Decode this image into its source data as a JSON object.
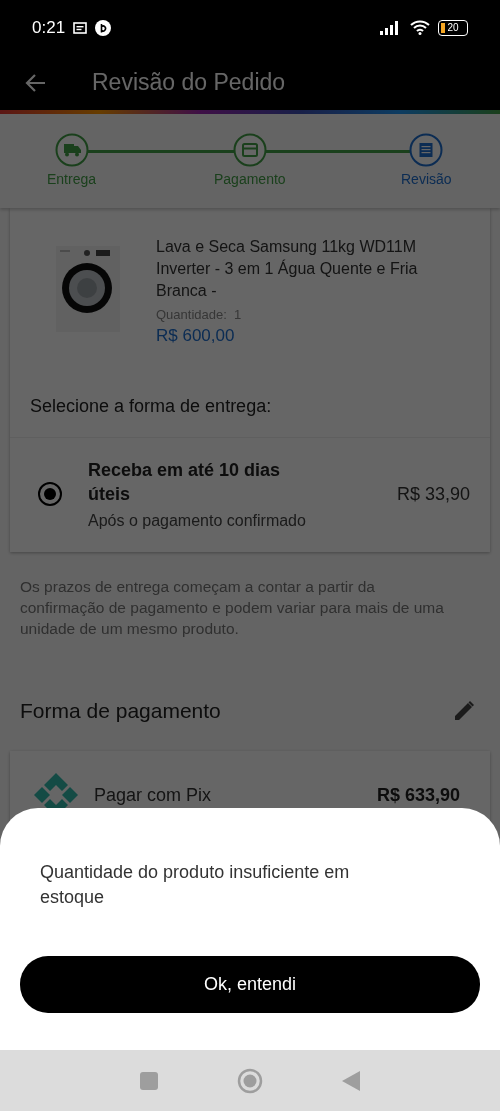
{
  "status_bar": {
    "time": "0:21",
    "battery": "20"
  },
  "app_bar": {
    "title": "Revisão do Pedido"
  },
  "steps": [
    {
      "label": "Entrega",
      "selected": false
    },
    {
      "label": "Pagamento",
      "selected": false
    },
    {
      "label": "Revisão",
      "selected": true
    }
  ],
  "product": {
    "name": "Lava e Seca Samsung 11kg WD11M Inverter - 3 em 1 Água Quente e Fria Branca -",
    "quantity_label": "Quantidade:",
    "quantity": "1",
    "price": "R$ 600,00"
  },
  "delivery": {
    "heading": "Selecione a forma de entrega:",
    "options": [
      {
        "title": "Receba em até 10 dias úteis",
        "subtitle": "Após o pagamento confirmado",
        "price": "R$ 33,90",
        "selected": true
      }
    ]
  },
  "delivery_note": "Os prazos de entrega começam a contar a partir da confirmação de pagamento e podem variar para mais de uma unidade de um mesmo produto.",
  "payment": {
    "heading": "Forma de pagamento",
    "method": "Pagar com Pix",
    "total": "R$ 633,90"
  },
  "sheet": {
    "message": "Quantidade do produto insuficiente em estoque",
    "button": "Ok, entendi"
  }
}
